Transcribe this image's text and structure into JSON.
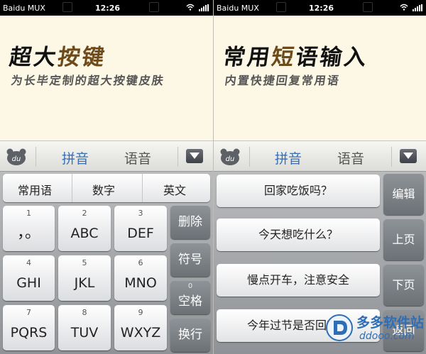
{
  "left": {
    "status": {
      "carrier": "Baidu MUX",
      "time": "12:26"
    },
    "banner": {
      "title_plain": "超大",
      "title_accent": "按键",
      "subtitle": "为长毕定制的超大按键皮肤"
    },
    "toolbar": {
      "logo": "du",
      "tab_active": "拼音",
      "tab_inactive": "语音"
    },
    "tabs": [
      "常用语",
      "数字",
      "英文"
    ],
    "keys": [
      {
        "num": "1",
        "label": "，。"
      },
      {
        "num": "2",
        "label": "ABC"
      },
      {
        "num": "3",
        "label": "DEF"
      },
      {
        "num": "4",
        "label": "GHI"
      },
      {
        "num": "5",
        "label": "JKL"
      },
      {
        "num": "6",
        "label": "MNO"
      },
      {
        "num": "7",
        "label": "PQRS"
      },
      {
        "num": "8",
        "label": "TUV"
      },
      {
        "num": "9",
        "label": "WXYZ"
      }
    ],
    "side_keys": {
      "delete": "删除",
      "symbol": "符号",
      "space_num": "0",
      "space": "空格",
      "enter": "换行"
    }
  },
  "right": {
    "status": {
      "carrier": "Baidu MUX",
      "time": "12:26"
    },
    "banner": {
      "title_part1": "常用",
      "title_accent": "短",
      "title_part2": "语输入",
      "subtitle": "内置快捷回复常用语"
    },
    "toolbar": {
      "logo": "du",
      "tab_active": "拼音",
      "tab_inactive": "语音"
    },
    "phrases": [
      "回家吃饭吗？",
      "今天想吃什么？",
      "慢点开车，注意安全",
      "今年过节是否回家？"
    ],
    "side_keys": {
      "edit": "编辑",
      "page_up": "上页",
      "page_down": "下页",
      "back": "返回"
    }
  },
  "watermark": {
    "title": "多多软件站",
    "url": "ddooo.com"
  },
  "colors": {
    "active_tab": "#3b6fb0",
    "accent_brown": "#6e4a1a",
    "cream": "#fdf8e6",
    "watermark_blue": "#2f6db5"
  },
  "icons": {
    "logo": "bear-du-icon",
    "hide": "triangle-down-icon",
    "wifi": "wifi-icon",
    "signal": "signal-bars-icon"
  }
}
